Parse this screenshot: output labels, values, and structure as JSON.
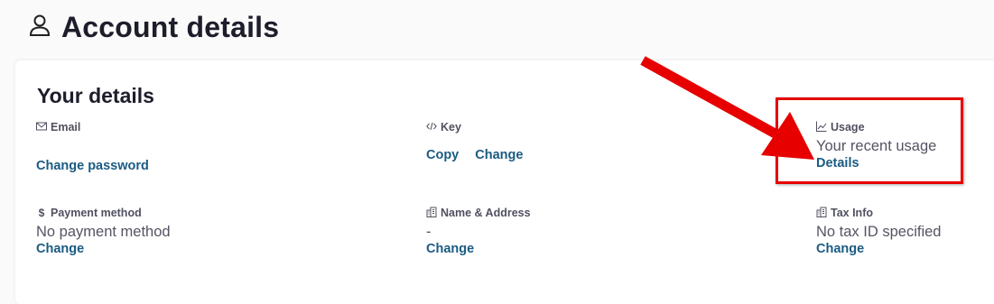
{
  "header": {
    "title": "Account details",
    "icon": "user-icon"
  },
  "card": {
    "title": "Your details",
    "email": {
      "label": "Email",
      "icon": "mail-icon",
      "link": "Change password"
    },
    "key": {
      "label": "Key",
      "icon": "code-icon",
      "links": [
        "Copy",
        "Change"
      ]
    },
    "usage": {
      "label": "Usage",
      "icon": "chart-icon",
      "value": "Your recent usage",
      "link": "Details"
    },
    "payment": {
      "label": "Payment method",
      "icon": "dollar-icon",
      "value": "No payment method",
      "link": "Change"
    },
    "name_address": {
      "label": "Name & Address",
      "icon": "building-icon",
      "value": "-",
      "link": "Change"
    },
    "tax": {
      "label": "Tax Info",
      "icon": "building-icon",
      "value": "No tax ID specified",
      "link": "Change"
    }
  },
  "annotation": {
    "color": "#e60000"
  }
}
